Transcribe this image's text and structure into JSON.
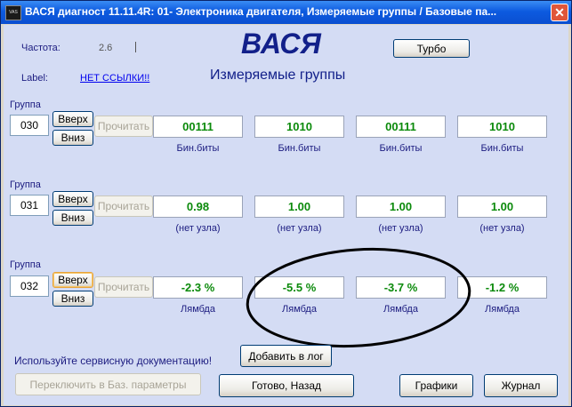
{
  "window": {
    "title": "ВАСЯ диагност 11.11.4R: 01- Электроника двигателя,  Измеряемые группы / Базовые па...",
    "icon_text": "VAS"
  },
  "header": {
    "freq_label": "Частота:",
    "freq_value": "2.6",
    "label_label": "Label:",
    "label_link": "НЕТ ССЫЛКИ!!",
    "app_name": "ВАСЯ",
    "subtitle": "Измеряемые группы",
    "turbo_button": "Турбо"
  },
  "groups": [
    {
      "label": "Группа",
      "number": "030",
      "up": "Вверх",
      "down": "Вниз",
      "read": "Прочитать",
      "values": [
        "00111",
        "1010",
        "00111",
        "1010"
      ],
      "units": [
        "Бин.биты",
        "Бин.биты",
        "Бин.биты",
        "Бин.биты"
      ]
    },
    {
      "label": "Группа",
      "number": "031",
      "up": "Вверх",
      "down": "Вниз",
      "read": "Прочитать",
      "values": [
        "0.98",
        "1.00",
        "1.00",
        "1.00"
      ],
      "units": [
        "(нет узла)",
        "(нет узла)",
        "(нет узла)",
        "(нет узла)"
      ]
    },
    {
      "label": "Группа",
      "number": "032",
      "up": "Вверх",
      "down": "Вниз",
      "read": "Прочитать",
      "values": [
        "-2.3 %",
        "-5.5 %",
        "-3.7 %",
        "-1.2 %"
      ],
      "units": [
        "Лямбда",
        "Лямбда",
        "Лямбда",
        "Лямбда"
      ]
    }
  ],
  "footer": {
    "service_hint": "Используйте сервисную документацию!",
    "add_log": "Добавить в лог",
    "switch_basic": "Переключить в Баз. параметры",
    "done_back": "Готово, Назад",
    "graphs": "Графики",
    "journal": "Журнал"
  },
  "colors": {
    "background": "#d4dcf4",
    "value_text": "#0b8a0b",
    "title_text": "#12208a",
    "titlebar": "#0d5be0"
  }
}
